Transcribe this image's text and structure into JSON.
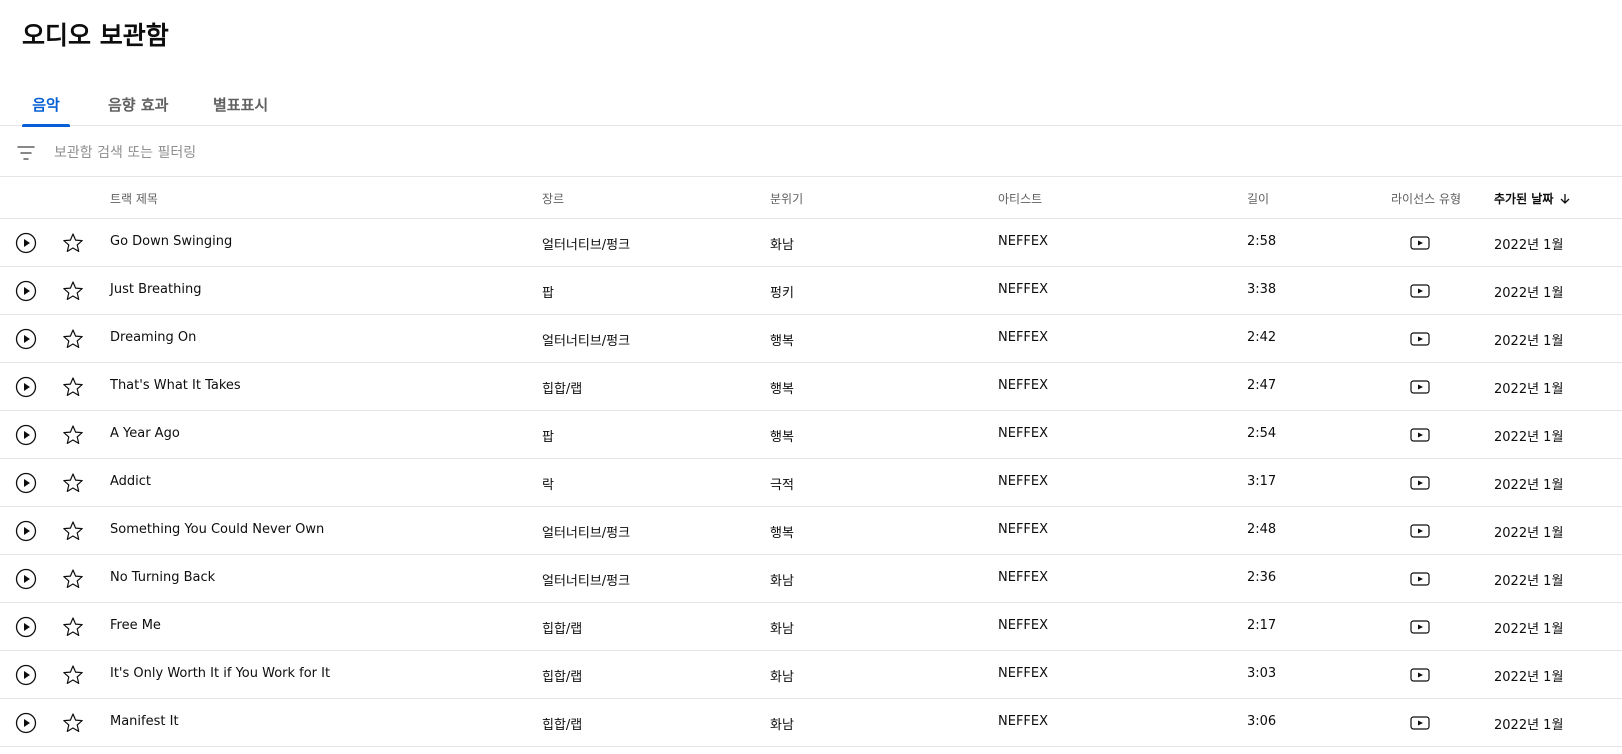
{
  "page": {
    "title": "오디오 보관함"
  },
  "tabs": [
    {
      "label": "음악",
      "active": true
    },
    {
      "label": "음향 효과",
      "active": false
    },
    {
      "label": "별표표시",
      "active": false
    }
  ],
  "filter": {
    "placeholder": "보관함 검색 또는 필터링",
    "value": ""
  },
  "columns": {
    "title": "트랙 제목",
    "genre": "장르",
    "mood": "분위기",
    "artist": "아티스트",
    "length": "길이",
    "license": "라이선스 유형",
    "date_added": "추가된 날짜"
  },
  "sort": {
    "column": "date_added",
    "direction": "desc"
  },
  "tracks": [
    {
      "title": "Go Down Swinging",
      "genre": "얼터너티브/펑크",
      "mood": "화남",
      "artist": "NEFFEX",
      "length": "2:58",
      "date": "2022년 1월"
    },
    {
      "title": "Just Breathing",
      "genre": "팝",
      "mood": "펑키",
      "artist": "NEFFEX",
      "length": "3:38",
      "date": "2022년 1월"
    },
    {
      "title": "Dreaming On",
      "genre": "얼터너티브/펑크",
      "mood": "행복",
      "artist": "NEFFEX",
      "length": "2:42",
      "date": "2022년 1월"
    },
    {
      "title": "That's What It Takes",
      "genre": "힙합/랩",
      "mood": "행복",
      "artist": "NEFFEX",
      "length": "2:47",
      "date": "2022년 1월"
    },
    {
      "title": "A Year Ago",
      "genre": "팝",
      "mood": "행복",
      "artist": "NEFFEX",
      "length": "2:54",
      "date": "2022년 1월"
    },
    {
      "title": "Addict",
      "genre": "락",
      "mood": "극적",
      "artist": "NEFFEX",
      "length": "3:17",
      "date": "2022년 1월"
    },
    {
      "title": "Something You Could Never Own",
      "genre": "얼터너티브/펑크",
      "mood": "행복",
      "artist": "NEFFEX",
      "length": "2:48",
      "date": "2022년 1월"
    },
    {
      "title": "No Turning Back",
      "genre": "얼터너티브/펑크",
      "mood": "화남",
      "artist": "NEFFEX",
      "length": "2:36",
      "date": "2022년 1월"
    },
    {
      "title": "Free Me",
      "genre": "힙합/랩",
      "mood": "화남",
      "artist": "NEFFEX",
      "length": "2:17",
      "date": "2022년 1월"
    },
    {
      "title": "It's Only Worth It if You Work for It",
      "genre": "힙합/랩",
      "mood": "화남",
      "artist": "NEFFEX",
      "length": "3:03",
      "date": "2022년 1월"
    },
    {
      "title": "Manifest It",
      "genre": "힙합/랩",
      "mood": "화남",
      "artist": "NEFFEX",
      "length": "3:06",
      "date": "2022년 1월"
    }
  ],
  "icons": {
    "filter": "filter-icon",
    "play": "play-circle-icon",
    "star": "star-outline-icon",
    "license": "youtube-license-icon",
    "sort": "arrow-down-icon"
  },
  "colors": {
    "accent": "#065fd4",
    "text": "#0d0d0d",
    "secondary": "#606060",
    "divider": "#e5e5e5"
  }
}
